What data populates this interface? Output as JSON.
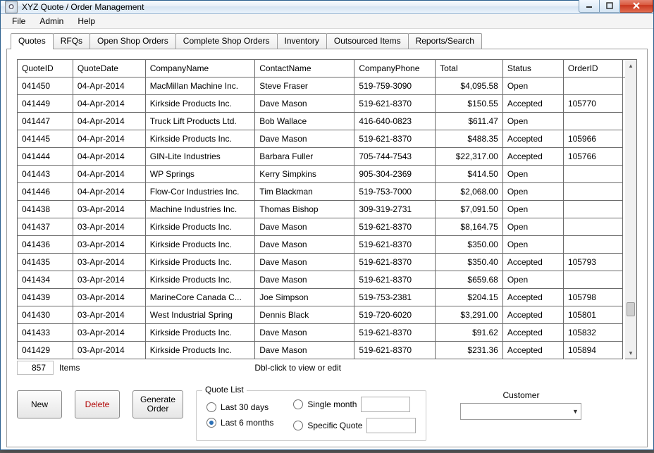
{
  "window": {
    "title": "XYZ Quote / Order Management",
    "app_icon_letter": "O"
  },
  "menu": {
    "file": "File",
    "admin": "Admin",
    "help": "Help"
  },
  "tabs": [
    {
      "label": "Quotes",
      "active": true
    },
    {
      "label": "RFQs"
    },
    {
      "label": "Open Shop Orders"
    },
    {
      "label": "Complete Shop Orders"
    },
    {
      "label": "Inventory"
    },
    {
      "label": "Outsourced Items"
    },
    {
      "label": "Reports/Search"
    }
  ],
  "grid": {
    "columns": [
      "QuoteID",
      "QuoteDate",
      "CompanyName",
      "ContactName",
      "CompanyPhone",
      "Total",
      "Status",
      "OrderID"
    ],
    "rows": [
      {
        "QuoteID": "041450",
        "QuoteDate": "04-Apr-2014",
        "CompanyName": "MacMillan Machine Inc.",
        "ContactName": "Steve Fraser",
        "CompanyPhone": "519-759-3090",
        "Total": "$4,095.58",
        "Status": "Open",
        "OrderID": ""
      },
      {
        "QuoteID": "041449",
        "QuoteDate": "04-Apr-2014",
        "CompanyName": "Kirkside Products Inc.",
        "ContactName": "Dave Mason",
        "CompanyPhone": "519-621-8370",
        "Total": "$150.55",
        "Status": "Accepted",
        "OrderID": "105770"
      },
      {
        "QuoteID": "041447",
        "QuoteDate": "04-Apr-2014",
        "CompanyName": "Truck Lift Products Ltd.",
        "ContactName": "Bob Wallace",
        "CompanyPhone": "416-640-0823",
        "Total": "$611.47",
        "Status": "Open",
        "OrderID": ""
      },
      {
        "QuoteID": "041445",
        "QuoteDate": "04-Apr-2014",
        "CompanyName": "Kirkside Products Inc.",
        "ContactName": "Dave Mason",
        "CompanyPhone": "519-621-8370",
        "Total": "$488.35",
        "Status": "Accepted",
        "OrderID": "105966"
      },
      {
        "QuoteID": "041444",
        "QuoteDate": "04-Apr-2014",
        "CompanyName": "GIN-Lite Industries",
        "ContactName": "Barbara Fuller",
        "CompanyPhone": "705-744-7543",
        "Total": "$22,317.00",
        "Status": "Accepted",
        "OrderID": "105766"
      },
      {
        "QuoteID": "041443",
        "QuoteDate": "04-Apr-2014",
        "CompanyName": "WP Springs",
        "ContactName": "Kerry Simpkins",
        "CompanyPhone": "905-304-2369",
        "Total": "$414.50",
        "Status": "Open",
        "OrderID": ""
      },
      {
        "QuoteID": "041446",
        "QuoteDate": "04-Apr-2014",
        "CompanyName": "Flow-Cor Industries Inc.",
        "ContactName": "Tim Blackman",
        "CompanyPhone": "519-753-7000",
        "Total": "$2,068.00",
        "Status": "Open",
        "OrderID": ""
      },
      {
        "QuoteID": "041438",
        "QuoteDate": "03-Apr-2014",
        "CompanyName": "Machine Industries Inc.",
        "ContactName": "Thomas Bishop",
        "CompanyPhone": "309-319-2731",
        "Total": "$7,091.50",
        "Status": "Open",
        "OrderID": ""
      },
      {
        "QuoteID": "041437",
        "QuoteDate": "03-Apr-2014",
        "CompanyName": "Kirkside Products Inc.",
        "ContactName": "Dave Mason",
        "CompanyPhone": "519-621-8370",
        "Total": "$8,164.75",
        "Status": "Open",
        "OrderID": ""
      },
      {
        "QuoteID": "041436",
        "QuoteDate": "03-Apr-2014",
        "CompanyName": "Kirkside Products Inc.",
        "ContactName": "Dave Mason",
        "CompanyPhone": "519-621-8370",
        "Total": "$350.00",
        "Status": "Open",
        "OrderID": ""
      },
      {
        "QuoteID": "041435",
        "QuoteDate": "03-Apr-2014",
        "CompanyName": "Kirkside Products Inc.",
        "ContactName": "Dave Mason",
        "CompanyPhone": "519-621-8370",
        "Total": "$350.40",
        "Status": "Accepted",
        "OrderID": "105793"
      },
      {
        "QuoteID": "041434",
        "QuoteDate": "03-Apr-2014",
        "CompanyName": "Kirkside Products Inc.",
        "ContactName": "Dave Mason",
        "CompanyPhone": "519-621-8370",
        "Total": "$659.68",
        "Status": "Open",
        "OrderID": ""
      },
      {
        "QuoteID": "041439",
        "QuoteDate": "03-Apr-2014",
        "CompanyName": "MarineCore Canada C...",
        "ContactName": "Joe Simpson",
        "CompanyPhone": "519-753-2381",
        "Total": "$204.15",
        "Status": "Accepted",
        "OrderID": "105798"
      },
      {
        "QuoteID": "041430",
        "QuoteDate": "03-Apr-2014",
        "CompanyName": "West Industrial Spring",
        "ContactName": "Dennis Black",
        "CompanyPhone": "519-720-6020",
        "Total": "$3,291.00",
        "Status": "Accepted",
        "OrderID": "105801"
      },
      {
        "QuoteID": "041433",
        "QuoteDate": "03-Apr-2014",
        "CompanyName": "Kirkside Products Inc.",
        "ContactName": "Dave Mason",
        "CompanyPhone": "519-621-8370",
        "Total": "$91.62",
        "Status": "Accepted",
        "OrderID": "105832"
      },
      {
        "QuoteID": "041429",
        "QuoteDate": "03-Apr-2014",
        "CompanyName": "Kirkside Products Inc.",
        "ContactName": "Dave Mason",
        "CompanyPhone": "519-621-8370",
        "Total": "$231.36",
        "Status": "Accepted",
        "OrderID": "105894"
      }
    ]
  },
  "footer": {
    "count": "857",
    "items_label": "Items",
    "hint": "Dbl-click to view or edit"
  },
  "buttons": {
    "new": "New",
    "delete": "Delete",
    "generate_order_l1": "Generate",
    "generate_order_l2": "Order"
  },
  "quote_list": {
    "legend": "Quote List",
    "last30": "Last 30 days",
    "last6": "Last 6 months",
    "single_month": "Single month",
    "specific_quote": "Specific Quote",
    "selected": "last6"
  },
  "customer": {
    "label": "Customer",
    "value": ""
  }
}
